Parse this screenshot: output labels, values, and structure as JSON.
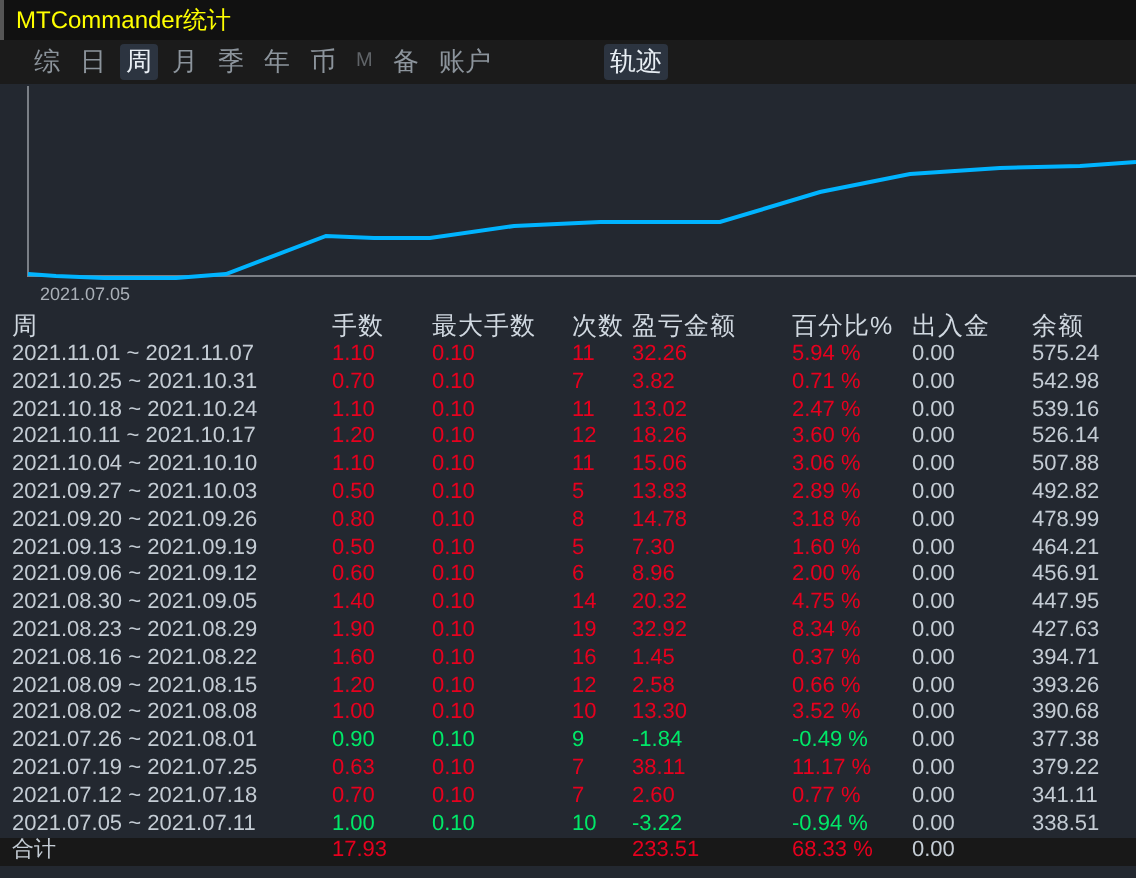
{
  "window": {
    "title": "MTCommander统计"
  },
  "tabs": [
    {
      "label": "综",
      "selected": false,
      "disabled": false
    },
    {
      "label": "日",
      "selected": false,
      "disabled": false
    },
    {
      "label": "周",
      "selected": true,
      "disabled": false
    },
    {
      "label": "月",
      "selected": false,
      "disabled": false
    },
    {
      "label": "季",
      "selected": false,
      "disabled": false
    },
    {
      "label": "年",
      "selected": false,
      "disabled": false
    },
    {
      "label": "币",
      "selected": false,
      "disabled": false
    },
    {
      "label": "M",
      "selected": false,
      "disabled": true
    },
    {
      "label": "备",
      "selected": false,
      "disabled": false
    },
    {
      "label": "账户",
      "selected": false,
      "disabled": false
    }
  ],
  "view_tabs": [
    {
      "label": "轨迹",
      "selected": true
    }
  ],
  "chart": {
    "start_label": "2021.07.05"
  },
  "table": {
    "columns": [
      "周",
      "手数",
      "最大手数",
      "次数",
      "盈亏金额",
      "百分比%",
      "出入金",
      "余额"
    ],
    "rows": [
      {
        "cells": [
          "2021.11.01 ~ 2021.11.07",
          "1.10",
          "0.10",
          "11",
          "32.26",
          "5.94 %",
          "0.00",
          "575.24"
        ],
        "loss": false
      },
      {
        "cells": [
          "2021.10.25 ~ 2021.10.31",
          "0.70",
          "0.10",
          "7",
          "3.82",
          "0.71 %",
          "0.00",
          "542.98"
        ],
        "loss": false
      },
      {
        "cells": [
          "2021.10.18 ~ 2021.10.24",
          "1.10",
          "0.10",
          "11",
          "13.02",
          "2.47 %",
          "0.00",
          "539.16"
        ],
        "loss": false
      },
      {
        "cells": [
          "2021.10.11 ~ 2021.10.17",
          "1.20",
          "0.10",
          "12",
          "18.26",
          "3.60 %",
          "0.00",
          "526.14"
        ],
        "loss": false
      },
      {
        "cells": [
          "2021.10.04 ~ 2021.10.10",
          "1.10",
          "0.10",
          "11",
          "15.06",
          "3.06 %",
          "0.00",
          "507.88"
        ],
        "loss": false
      },
      {
        "cells": [
          "2021.09.27 ~ 2021.10.03",
          "0.50",
          "0.10",
          "5",
          "13.83",
          "2.89 %",
          "0.00",
          "492.82"
        ],
        "loss": false
      },
      {
        "cells": [
          "2021.09.20 ~ 2021.09.26",
          "0.80",
          "0.10",
          "8",
          "14.78",
          "3.18 %",
          "0.00",
          "478.99"
        ],
        "loss": false
      },
      {
        "cells": [
          "2021.09.13 ~ 2021.09.19",
          "0.50",
          "0.10",
          "5",
          "7.30",
          "1.60 %",
          "0.00",
          "464.21"
        ],
        "loss": false
      },
      {
        "cells": [
          "2021.09.06 ~ 2021.09.12",
          "0.60",
          "0.10",
          "6",
          "8.96",
          "2.00 %",
          "0.00",
          "456.91"
        ],
        "loss": false
      },
      {
        "cells": [
          "2021.08.30 ~ 2021.09.05",
          "1.40",
          "0.10",
          "14",
          "20.32",
          "4.75 %",
          "0.00",
          "447.95"
        ],
        "loss": false
      },
      {
        "cells": [
          "2021.08.23 ~ 2021.08.29",
          "1.90",
          "0.10",
          "19",
          "32.92",
          "8.34 %",
          "0.00",
          "427.63"
        ],
        "loss": false
      },
      {
        "cells": [
          "2021.08.16 ~ 2021.08.22",
          "1.60",
          "0.10",
          "16",
          "1.45",
          "0.37 %",
          "0.00",
          "394.71"
        ],
        "loss": false
      },
      {
        "cells": [
          "2021.08.09 ~ 2021.08.15",
          "1.20",
          "0.10",
          "12",
          "2.58",
          "0.66 %",
          "0.00",
          "393.26"
        ],
        "loss": false
      },
      {
        "cells": [
          "2021.08.02 ~ 2021.08.08",
          "1.00",
          "0.10",
          "10",
          "13.30",
          "3.52 %",
          "0.00",
          "390.68"
        ],
        "loss": false
      },
      {
        "cells": [
          "2021.07.26 ~ 2021.08.01",
          "0.90",
          "0.10",
          "9",
          "-1.84",
          "-0.49 %",
          "0.00",
          "377.38"
        ],
        "loss": true
      },
      {
        "cells": [
          "2021.07.19 ~ 2021.07.25",
          "0.63",
          "0.10",
          "7",
          "38.11",
          "11.17 %",
          "0.00",
          "379.22"
        ],
        "loss": false
      },
      {
        "cells": [
          "2021.07.12 ~ 2021.07.18",
          "0.70",
          "0.10",
          "7",
          "2.60",
          "0.77 %",
          "0.00",
          "341.11"
        ],
        "loss": false
      },
      {
        "cells": [
          "2021.07.05 ~ 2021.07.11",
          "1.00",
          "0.10",
          "10",
          "-3.22",
          "-0.94 %",
          "0.00",
          "338.51"
        ],
        "loss": true
      }
    ],
    "total": {
      "label": "合计",
      "lots": "17.93",
      "profit": "233.51",
      "percent": "68.33 %",
      "deposit": "0.00"
    }
  }
}
